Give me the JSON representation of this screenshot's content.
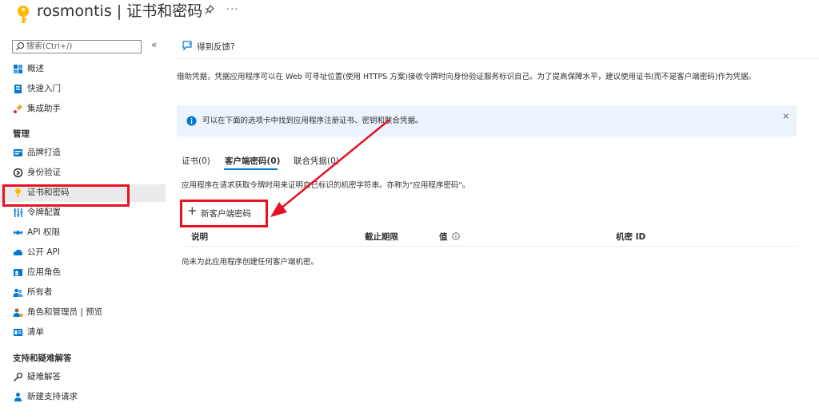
{
  "header": {
    "app_name": "rosmontis",
    "separator": " | ",
    "page_title": "证书和密码",
    "pin_icon": "pin-icon",
    "more": "···"
  },
  "sidebar": {
    "search_placeholder": "搜索(Ctrl+/)",
    "collapse": "«",
    "items_top": [
      {
        "label": "概述",
        "icon": "overview-icon"
      },
      {
        "label": "快速入门",
        "icon": "quickstart-icon"
      },
      {
        "label": "集成助手",
        "icon": "integration-assistant-icon"
      }
    ],
    "section_manage": "管理",
    "items_manage": [
      {
        "label": "品牌打造",
        "icon": "branding-icon"
      },
      {
        "label": "身份验证",
        "icon": "authentication-icon"
      },
      {
        "label": "证书和密码",
        "icon": "key-icon",
        "active": true
      },
      {
        "label": "令牌配置",
        "icon": "token-config-icon"
      },
      {
        "label": "API 权限",
        "icon": "api-permissions-icon"
      },
      {
        "label": "公开 API",
        "icon": "cloud-icon"
      },
      {
        "label": "应用角色",
        "icon": "app-roles-icon"
      },
      {
        "label": "所有者",
        "icon": "owners-icon"
      },
      {
        "label": "角色和管理员 | 预览",
        "icon": "roles-admins-icon"
      },
      {
        "label": "清单",
        "icon": "manifest-icon"
      }
    ],
    "section_support": "支持和疑难解答",
    "items_support": [
      {
        "label": "疑难解答",
        "icon": "wrench-icon"
      },
      {
        "label": "新建支持请求",
        "icon": "support-request-icon"
      }
    ]
  },
  "main": {
    "feedback": "得到反馈?",
    "description": "借助凭据，凭据应用程序可以在 Web 可寻址位置(使用 HTTPS 方案)接收令牌时向身份验证服务标识自己。为了提高保障水平，建议使用证书(而不是客户端密码)作为凭据。",
    "info_banner": "可以在下面的选项卡中找到应用程序注册证书、密钥和联合凭据。",
    "info_close": "×",
    "tabs": [
      {
        "label": "证书(0)"
      },
      {
        "label": "客户端密码(0)",
        "selected": true
      },
      {
        "label": "联合凭据(0)"
      }
    ],
    "secret_description": "应用程序在请求获取令牌时用来证明自己标识的机密字符串。亦称为\"应用程序密码\"。",
    "new_secret_label": "新客户端密码",
    "table_headers": {
      "description": "说明",
      "expires": "截止期限",
      "value": "值",
      "secret_id": "机密 ID"
    },
    "empty_message": "尚未为此应用程序创建任何客户端机密。"
  },
  "colors": {
    "accent": "#0078d4",
    "annotation_red": "#e81123",
    "key_yellow": "#ffb900",
    "info_bg": "#ebf3fc"
  }
}
